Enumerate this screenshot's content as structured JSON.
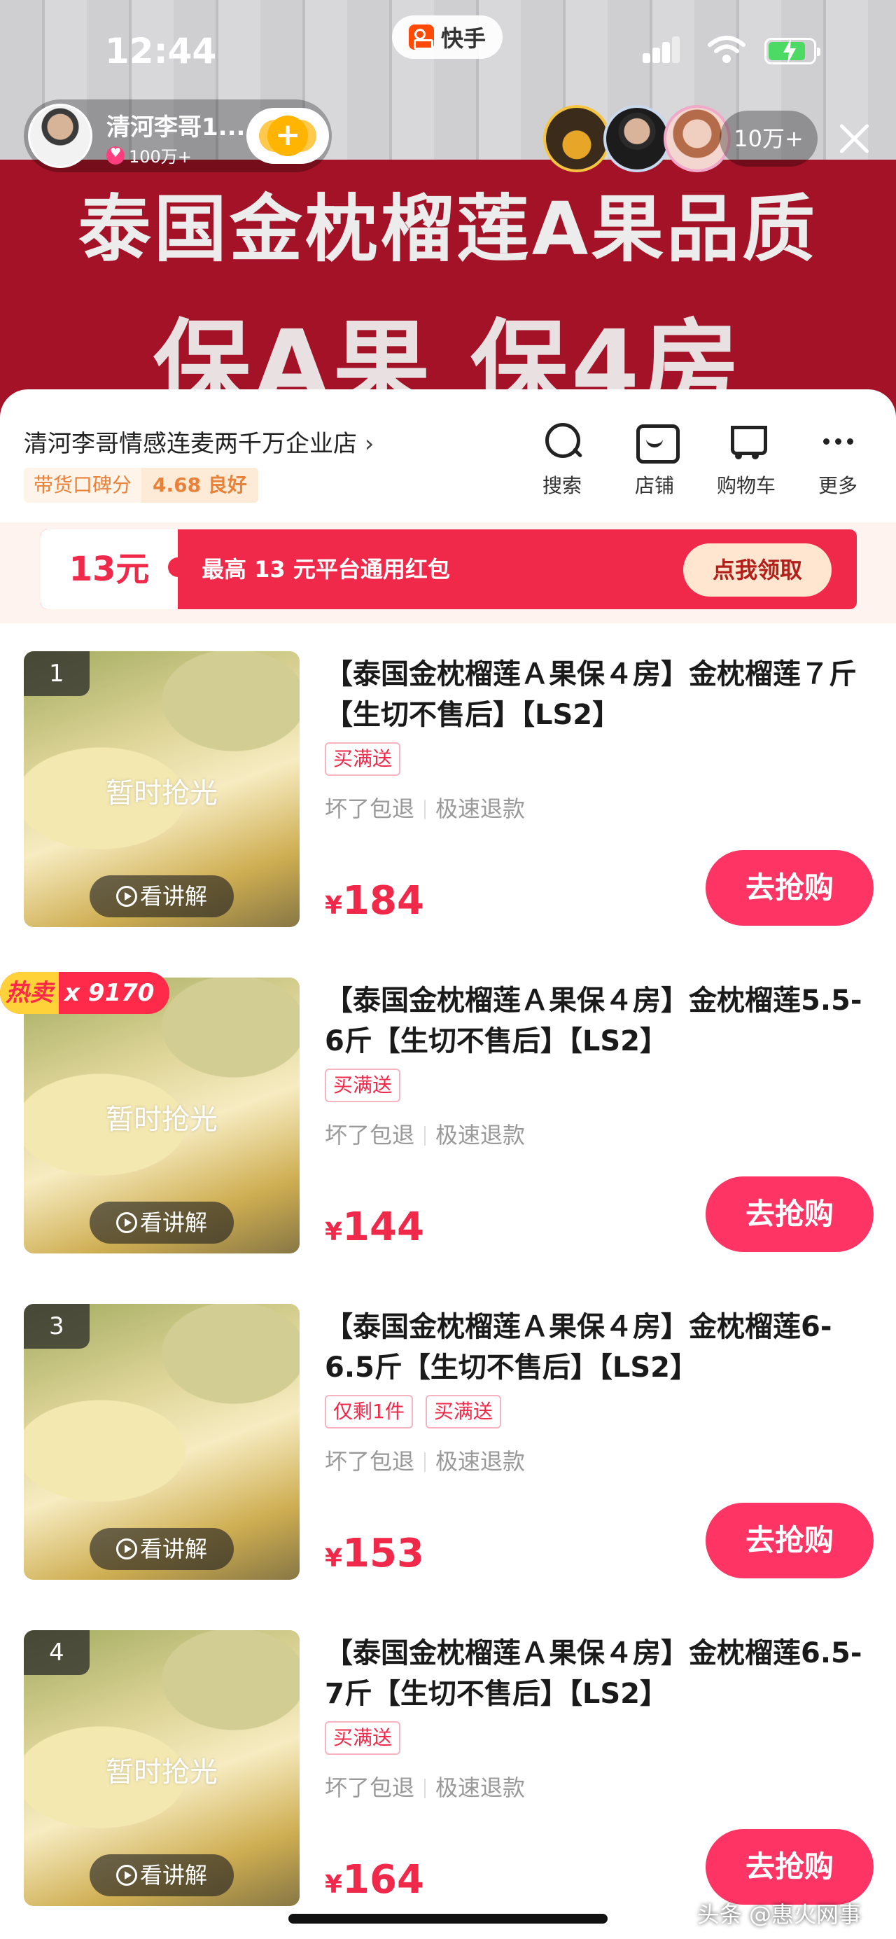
{
  "status": {
    "time": "12:44",
    "app_name": "快手"
  },
  "streamer": {
    "name": "清河李哥1...",
    "fans": "100万+"
  },
  "viewers": {
    "count": "10万+"
  },
  "banner": {
    "line1": "泰国金枕榴莲A果品质",
    "line2": "保A果 保4房"
  },
  "shop": {
    "name": "清河李哥情感连麦两千万企业店",
    "rating_label": "带货口碑分",
    "rating_value": "4.68 良好",
    "tools": [
      {
        "label": "搜索",
        "icon": "search-icon"
      },
      {
        "label": "店铺",
        "icon": "store-icon"
      },
      {
        "label": "购物车",
        "icon": "cart-icon"
      },
      {
        "label": "更多",
        "icon": "more-icon"
      }
    ]
  },
  "coupon": {
    "amount": "13元",
    "desc": "最高 13 元平台通用红包",
    "claim": "点我领取"
  },
  "products": [
    {
      "rank": "1",
      "title": "【泰国金枕榴莲Ａ果保４房】金枕榴莲７斤【生切不售后】【LS2】",
      "tags": [
        "买满送"
      ],
      "svc1": "坏了包退",
      "svc2": "极速退款",
      "cur": "¥",
      "price": "184",
      "soldout": "暂时抢光",
      "explain": "看讲解",
      "buy": "去抢购"
    },
    {
      "rank": "",
      "hot_tag": "热卖",
      "hot_count": "x 9170",
      "title": "【泰国金枕榴莲Ａ果保４房】金枕榴莲5.5-6斤【生切不售后】【LS2】",
      "tags": [
        "买满送"
      ],
      "svc1": "坏了包退",
      "svc2": "极速退款",
      "cur": "¥",
      "price": "144",
      "soldout": "暂时抢光",
      "explain": "看讲解",
      "buy": "去抢购"
    },
    {
      "rank": "3",
      "title": "【泰国金枕榴莲Ａ果保４房】金枕榴莲6-6.5斤【生切不售后】【LS2】",
      "tags": [
        "仅剩1件",
        "买满送"
      ],
      "svc1": "坏了包退",
      "svc2": "极速退款",
      "cur": "¥",
      "price": "153",
      "soldout": "",
      "explain": "看讲解",
      "buy": "去抢购"
    },
    {
      "rank": "4",
      "title": "【泰国金枕榴莲Ａ果保４房】金枕榴莲6.5-7斤【生切不售后】【LS2】",
      "tags": [
        "买满送"
      ],
      "svc1": "坏了包退",
      "svc2": "极速退款",
      "cur": "¥",
      "price": "164",
      "soldout": "暂时抢光",
      "explain": "看讲解",
      "buy": "去抢购"
    }
  ],
  "watermark": "头条 @惠火网事"
}
